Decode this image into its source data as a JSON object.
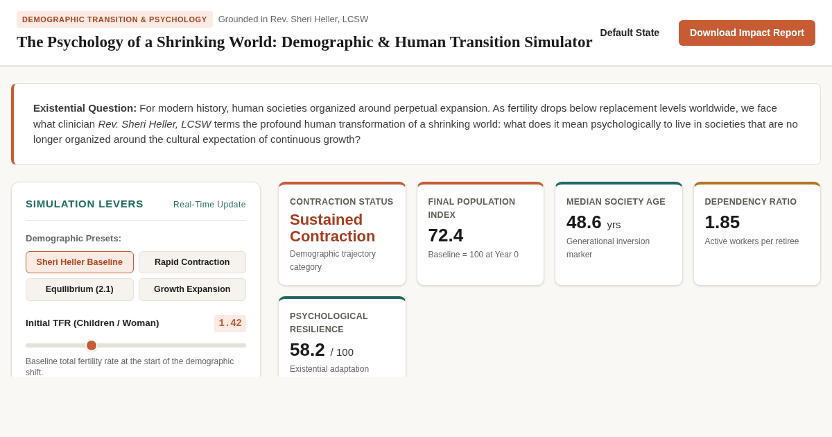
{
  "header": {
    "tag": "DEMOGRAPHIC TRANSITION & PSYCHOLOGY",
    "source": "Grounded in Rev. Sheri Heller, LCSW",
    "title": "The Psychology of a Shrinking World: Demographic & Human Transition Simulator",
    "buttons": [
      {
        "label": "Default State",
        "kind": "plain"
      },
      {
        "label": "Download Impact Report",
        "kind": "primary"
      }
    ]
  },
  "question": "**Existential Question:** For modern history, human societies organized around perpetual expansion. As fertility drops below replacement levels worldwide, we face what clinician *Rev. Sheri Heller, LCSW* terms the profound human transformation of a shrinking world: what does it mean psychologically to live in societies that are no longer organized around the cultural expectation of continuous growth?",
  "levers": {
    "title": "SIMULATION LEVERS",
    "update": "Real-Time Update",
    "presets_label": "Demographic Presets:",
    "presets": [
      {
        "label": "Sheri Heller Baseline",
        "selected": true
      },
      {
        "label": "Rapid Contraction",
        "selected": false
      },
      {
        "label": "Equilibrium (2.1)",
        "selected": false
      },
      {
        "label": "Growth Expansion",
        "selected": false
      }
    ],
    "slider": {
      "label": "Initial TFR (Children / Woman)",
      "reading": "1.42",
      "level": 0.3,
      "hint": "Baseline total fertility rate at the start of the demographic shift."
    }
  },
  "metrics": [
    {
      "label": "CONTRACTION STATUS",
      "value": "Sustained Contraction",
      "kind": "status",
      "note": "Demographic trajectory category",
      "color": "#c75b33"
    },
    {
      "label": "FINAL POPULATION INDEX",
      "value": "72.4",
      "kind": "number",
      "note": "Baseline = 100 at Year 0",
      "color": "#c75b33"
    },
    {
      "label": "MEDIAN SOCIETY AGE",
      "value": "48.6",
      "unit": "yrs",
      "kind": "number",
      "note": "Generational inversion marker",
      "color": "#1f6b62"
    },
    {
      "label": "DEPENDENCY RATIO",
      "value": "1.85",
      "kind": "number",
      "note": "Active workers per retiree",
      "color": "#b87320"
    },
    {
      "label": "PSYCHOLOGICAL RESILIENCE",
      "value": "58.2",
      "unit": "/ 100",
      "kind": "number",
      "note": "Existential adaptation",
      "color": "#1f6b62"
    }
  ]
}
